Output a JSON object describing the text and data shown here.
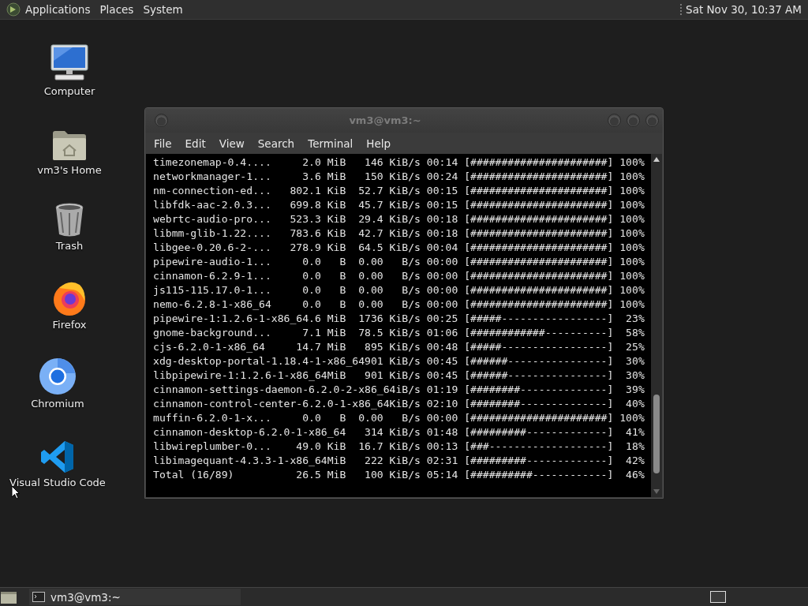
{
  "top_panel": {
    "menus": [
      "Applications",
      "Places",
      "System"
    ],
    "clock": "Sat Nov 30, 10:37 AM"
  },
  "desktop_icons": [
    {
      "label": "Computer",
      "kind": "computer"
    },
    {
      "label": "vm3's Home",
      "kind": "home"
    },
    {
      "label": "Trash",
      "kind": "trash"
    },
    {
      "label": "Firefox",
      "kind": "firefox"
    },
    {
      "label": "Chromium",
      "kind": "chromium"
    },
    {
      "label": "Visual Studio Code",
      "kind": "vscode"
    }
  ],
  "terminal": {
    "title": "vm3@vm3:~",
    "menu": [
      "File",
      "Edit",
      "View",
      "Search",
      "Terminal",
      "Help"
    ],
    "lines": [
      "timezonemap-0.4....     2.0 MiB   146 KiB/s 00:14 [######################] 100%",
      "networkmanager-1...     3.6 MiB   150 KiB/s 00:24 [######################] 100%",
      "nm-connection-ed...   802.1 KiB  52.7 KiB/s 00:15 [######################] 100%",
      "libfdk-aac-2.0.3...   699.8 KiB  45.7 KiB/s 00:15 [######################] 100%",
      "webrtc-audio-pro...   523.3 KiB  29.4 KiB/s 00:18 [######################] 100%",
      "libmm-glib-1.22....   783.6 KiB  42.7 KiB/s 00:18 [######################] 100%",
      "libgee-0.20.6-2-...   278.9 KiB  64.5 KiB/s 00:04 [######################] 100%",
      "pipewire-audio-1...     0.0   B  0.00   B/s 00:00 [######################] 100%",
      "cinnamon-6.2.9-1...     0.0   B  0.00   B/s 00:00 [######################] 100%",
      "js115-115.17.0-1...     0.0   B  0.00   B/s 00:00 [######################] 100%",
      "nemo-6.2.8-1-x86_64     0.0   B  0.00   B/s 00:00 [######################] 100%",
      "pipewire-1:1.2.6-1-x86_64.6 MiB  1736 KiB/s 00:25 [#####-----------------]  23%",
      "gnome-background...     7.1 MiB  78.5 KiB/s 01:06 [############----------]  58%",
      "cjs-6.2.0-1-x86_64     14.7 MiB   895 KiB/s 00:48 [#####-----------------]  25%",
      "xdg-desktop-portal-1.18.4-1-x86_64901 KiB/s 00:45 [######----------------]  30%",
      "libpipewire-1:1.2.6-1-x86_64MiB   901 KiB/s 00:45 [######----------------]  30%",
      "cinnamon-settings-daemon-6.2.0-2-x86_64iB/s 01:19 [########--------------]  39%",
      "cinnamon-control-center-6.2.0-1-x86_64KiB/s 02:10 [########--------------]  40%",
      "muffin-6.2.0-1-x...     0.0   B  0.00   B/s 00:00 [######################] 100%",
      "cinnamon-desktop-6.2.0-1-x86_64   314 KiB/s 01:48 [#########-------------]  41%",
      "libwireplumber-0...    49.0 KiB  16.7 KiB/s 00:13 [###-------------------]  18%",
      "libimagequant-4.3.3-1-x86_64MiB   222 KiB/s 02:31 [#########-------------]  42%",
      "Total (16/89)          26.5 MiB   100 KiB/s 05:14 [##########------------]  46%"
    ]
  },
  "taskbar": {
    "tasks": [
      {
        "label": "vm3@vm3:~"
      }
    ]
  }
}
